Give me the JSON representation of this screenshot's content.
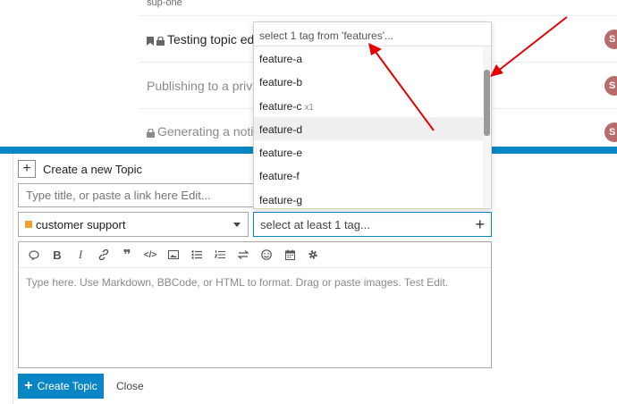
{
  "topic_list": {
    "category_label": "sup-one",
    "rows": [
      {
        "title": "Testing topic edi",
        "bookmarked": true,
        "locked": true,
        "avatar_letter": "S"
      },
      {
        "title": "Publishing to a priva",
        "bookmarked": false,
        "locked": false,
        "avatar_letter": "S"
      },
      {
        "title": "Generating a notifi",
        "bookmarked": false,
        "locked": true,
        "avatar_letter": "S"
      }
    ]
  },
  "composer": {
    "action_label": "Create a new Topic",
    "title_placeholder": "Type title, or paste a link here Edit...",
    "category": {
      "selected": "customer support",
      "color": "#f0a030"
    },
    "tag_placeholder": "select at least 1 tag...",
    "toolbar_icons": [
      "quote-icon",
      "bold-icon",
      "italic-icon",
      "link-icon",
      "blockquote-icon",
      "code-icon",
      "image-icon",
      "bullet-list-icon",
      "numbered-list-icon",
      "direction-icon",
      "emoji-icon",
      "calendar-icon",
      "gear-icon"
    ],
    "editor_placeholder": "Type here. Use Markdown, BBCode, or HTML to format. Drag or paste images. Test Edit.",
    "submit_label": "Create Topic",
    "cancel_label": "Close"
  },
  "tag_dropdown": {
    "filter_text": "select 1 tag from 'features'...",
    "items": [
      {
        "label": "feature-a",
        "count": ""
      },
      {
        "label": "feature-b",
        "count": ""
      },
      {
        "label": "feature-c",
        "count": "x1"
      },
      {
        "label": "feature-d",
        "count": ""
      },
      {
        "label": "feature-e",
        "count": ""
      },
      {
        "label": "feature-f",
        "count": ""
      },
      {
        "label": "feature-g",
        "count": ""
      }
    ],
    "highlighted_index": 3
  },
  "colors": {
    "accent": "#0b86c5",
    "annotation": "#e60000"
  }
}
